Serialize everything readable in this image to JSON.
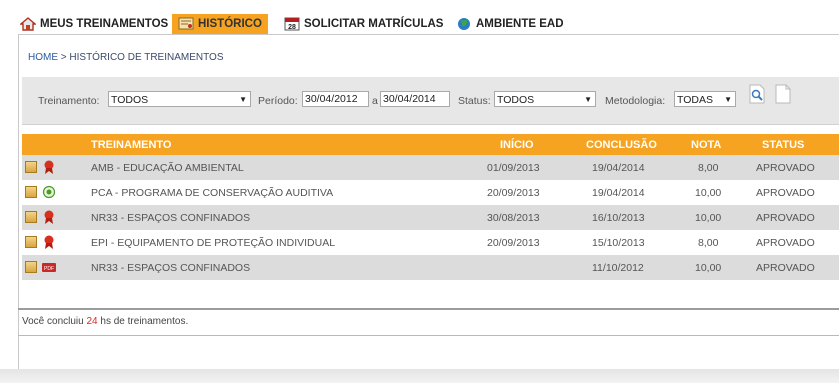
{
  "nav": {
    "items": [
      {
        "label": "MEUS TREINAMENTOS",
        "icon": "home-icon"
      },
      {
        "label": "HISTÓRICO",
        "icon": "certificate-icon",
        "active": true
      },
      {
        "label": "SOLICITAR MATRÍCULAS",
        "icon": "calendar-icon",
        "icon_text": "28"
      },
      {
        "label": "AMBIENTE EAD",
        "icon": "globe-icon"
      }
    ]
  },
  "breadcrumb": {
    "home": "HOME",
    "sep": ">",
    "current": "HISTÓRICO DE TREINAMENTOS"
  },
  "filters": {
    "treinamento_label": "Treinamento:",
    "treinamento_value": "TODOS",
    "periodo_label": "Período:",
    "periodo_from": "30/04/2012",
    "periodo_sep": "a",
    "periodo_to": "30/04/2014",
    "status_label": "Status:",
    "status_value": "TODOS",
    "metodologia_label": "Metodologia:",
    "metodologia_value": "TODAS",
    "arrow": "▼",
    "search_icon": "magnifier-icon",
    "clear_icon": "blank-page-icon"
  },
  "table": {
    "headers": {
      "treinamento": "TREINAMENTO",
      "inicio": "INÍCIO",
      "conclusao": "CONCLUSÃO",
      "nota": "NOTA",
      "status": "STATUS"
    },
    "rows": [
      {
        "treinamento": "AMB - EDUCAÇÃO AMBIENTAL",
        "inicio": "01/09/2013",
        "conclusao": "19/04/2014",
        "nota": "8,00",
        "status": "APROVADO",
        "icon": "ribbon-icon"
      },
      {
        "treinamento": "PCA - PROGRAMA DE CONSERVAÇÃO AUDITIVA",
        "inicio": "20/09/2013",
        "conclusao": "19/04/2014",
        "nota": "10,00",
        "status": "APROVADO",
        "icon": "target-icon"
      },
      {
        "treinamento": "NR33 - ESPAÇOS CONFINADOS",
        "inicio": "30/08/2013",
        "conclusao": "16/10/2013",
        "nota": "10,00",
        "status": "APROVADO",
        "icon": "ribbon-icon"
      },
      {
        "treinamento": "EPI - EQUIPAMENTO DE PROTEÇÃO INDIVIDUAL",
        "inicio": "20/09/2013",
        "conclusao": "15/10/2013",
        "nota": "8,00",
        "status": "APROVADO",
        "icon": "ribbon-icon"
      },
      {
        "treinamento": "NR33 - ESPAÇOS CONFINADOS",
        "inicio": "",
        "conclusao": "11/10/2012",
        "nota": "10,00",
        "status": "APROVADO",
        "icon": "pdf-icon"
      }
    ]
  },
  "summary": {
    "prefix": "Você concluiu",
    "hours": "24",
    "suffix": "hs de treinamentos."
  },
  "colors": {
    "accent": "#f5a320",
    "row_alt": "#dcdcdc",
    "highlight": "#e0291c"
  }
}
